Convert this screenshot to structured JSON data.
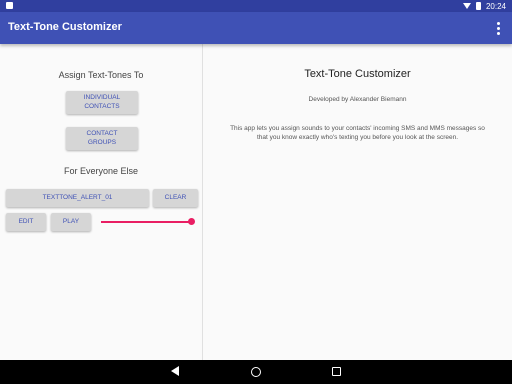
{
  "status_bar": {
    "time": "20:24"
  },
  "app_bar": {
    "title": "Text-Tone Customizer",
    "overflow_icon": "overflow-menu-icon"
  },
  "left_panel": {
    "assign_heading": "Assign Text-Tones To",
    "individual_contacts": {
      "line1": "INDIVIDUAL",
      "line2": "CONTACTS"
    },
    "contact_groups": {
      "line1": "CONTACT",
      "line2": "GROUPS"
    },
    "everyone_heading": "For Everyone Else",
    "tone_name": "TEXTTONE_ALERT_01",
    "clear_label": "CLEAR",
    "edit_label": "EDIT",
    "play_label": "PLAY",
    "volume_level": 1.0
  },
  "right_panel": {
    "title": "Text-Tone Customizer",
    "developer": "Developed by Alexander Biemann",
    "description_line1": "This app lets you assign sounds to your contacts' incoming SMS and MMS messages so",
    "description_line2": "that you know exactly who's texting you before you look at the screen."
  },
  "colors": {
    "primary": "#3f51b5",
    "primary_dark": "#303f9f",
    "accent": "#e91e63",
    "button_bg": "#d6d6d6"
  }
}
